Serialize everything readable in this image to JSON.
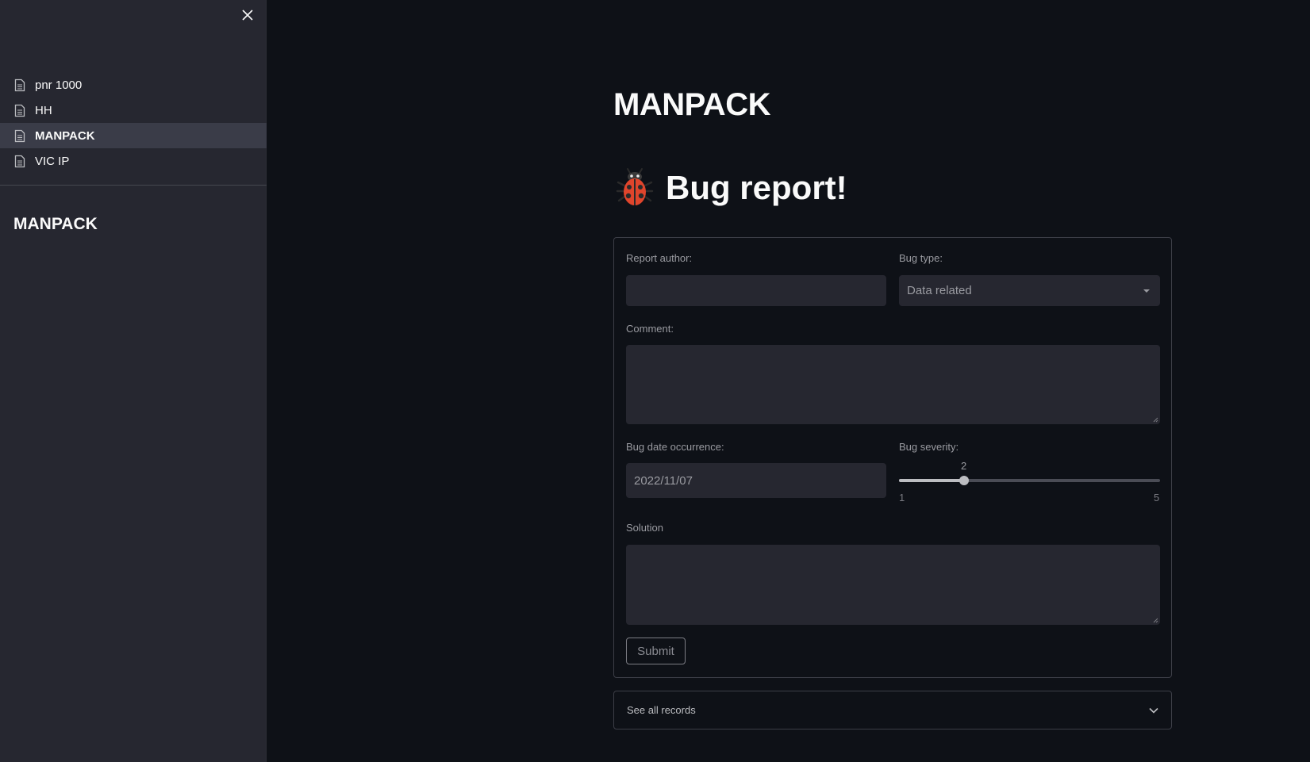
{
  "sidebar": {
    "close_icon": "close-icon",
    "nav": [
      {
        "label": "pnr 1000",
        "icon": "document-icon",
        "active": false
      },
      {
        "label": "HH",
        "icon": "document-icon",
        "active": false
      },
      {
        "label": "MANPACK",
        "icon": "document-icon",
        "active": true
      },
      {
        "label": "VIC IP",
        "icon": "document-icon",
        "active": false
      }
    ],
    "title": "MANPACK"
  },
  "main": {
    "page_title": "MANPACK",
    "bug_header": {
      "icon": "ladybug-icon",
      "text": "Bug report!"
    },
    "form": {
      "author_label": "Report author:",
      "author_value": "",
      "bug_type_label": "Bug type:",
      "bug_type_value": "Data related",
      "comment_label": "Comment:",
      "comment_value": "",
      "date_label": "Bug date occurrence:",
      "date_value": "2022/11/07",
      "severity_label": "Bug severity:",
      "severity_value": "2",
      "severity_min": "1",
      "severity_max": "5",
      "solution_label": "Solution",
      "solution_value": "",
      "submit_label": "Submit"
    },
    "expander_label": "See all records"
  },
  "colors": {
    "background": "#0e1117",
    "sidebar": "#262730",
    "input": "#262730",
    "text": "#fafafa",
    "muted": "#9a9ba1"
  }
}
